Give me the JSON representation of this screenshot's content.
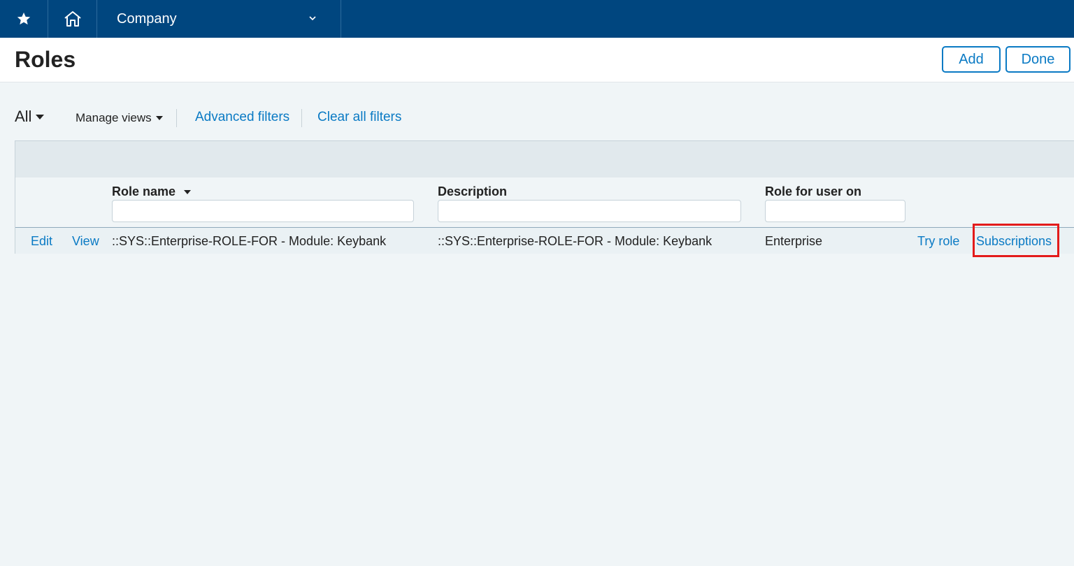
{
  "nav": {
    "company_label": "Company"
  },
  "header": {
    "title": "Roles",
    "add_label": "Add",
    "done_label": "Done"
  },
  "filters": {
    "view_label": "All",
    "manage_views_label": "Manage views",
    "advanced_filters_label": "Advanced filters",
    "clear_all_filters_label": "Clear all filters"
  },
  "table": {
    "columns": [
      {
        "label": "Role name",
        "sortable": true
      },
      {
        "label": "Description"
      },
      {
        "label": "Role for user on"
      }
    ],
    "rows": [
      {
        "edit_label": "Edit",
        "view_label": "View",
        "role_name": "::SYS::Enterprise-ROLE-FOR - Module: Keybank",
        "description": "::SYS::Enterprise-ROLE-FOR - Module: Keybank",
        "role_for_user_on": "Enterprise",
        "try_role_label": "Try role",
        "subscriptions_label": "Subscriptions"
      }
    ]
  },
  "colors": {
    "nav_bg": "#00467f",
    "link": "#0a7ac4",
    "highlight": "#e31b1b"
  }
}
